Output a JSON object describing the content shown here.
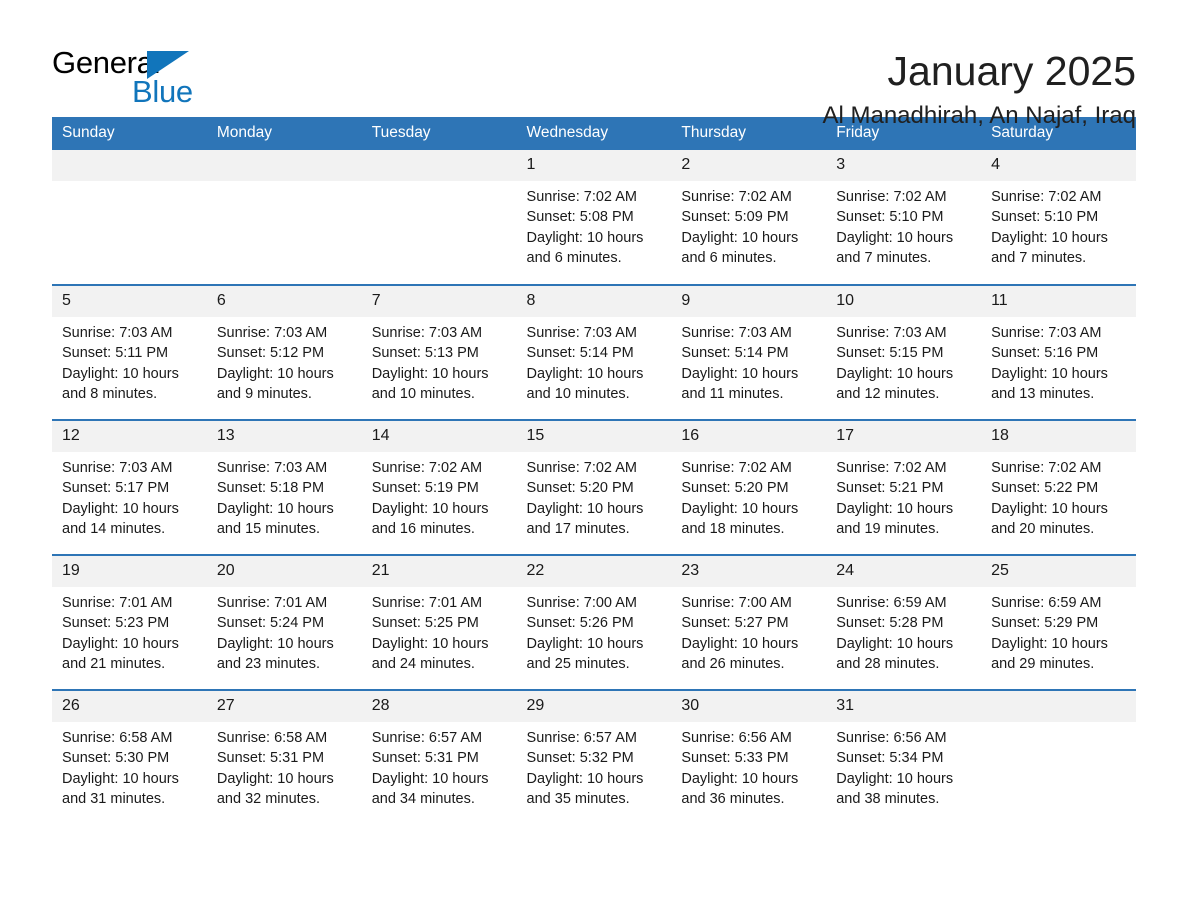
{
  "brand": {
    "name_part1": "General",
    "name_part2": "Blue",
    "triangle_color": "#1175bb",
    "accent_color": "#2e75b6"
  },
  "header": {
    "month_title": "January 2025",
    "location": "Al Manadhirah, An Najaf, Iraq"
  },
  "calendar": {
    "weekday_headers": [
      "Sunday",
      "Monday",
      "Tuesday",
      "Wednesday",
      "Thursday",
      "Friday",
      "Saturday"
    ],
    "weeks": [
      [
        {
          "day": "",
          "sunrise": "",
          "sunset": "",
          "daylight_line1": "",
          "daylight_line2": "",
          "empty": true
        },
        {
          "day": "",
          "sunrise": "",
          "sunset": "",
          "daylight_line1": "",
          "daylight_line2": "",
          "empty": true
        },
        {
          "day": "",
          "sunrise": "",
          "sunset": "",
          "daylight_line1": "",
          "daylight_line2": "",
          "empty": true
        },
        {
          "day": "1",
          "sunrise": "Sunrise: 7:02 AM",
          "sunset": "Sunset: 5:08 PM",
          "daylight_line1": "Daylight: 10 hours",
          "daylight_line2": "and 6 minutes.",
          "empty": false
        },
        {
          "day": "2",
          "sunrise": "Sunrise: 7:02 AM",
          "sunset": "Sunset: 5:09 PM",
          "daylight_line1": "Daylight: 10 hours",
          "daylight_line2": "and 6 minutes.",
          "empty": false
        },
        {
          "day": "3",
          "sunrise": "Sunrise: 7:02 AM",
          "sunset": "Sunset: 5:10 PM",
          "daylight_line1": "Daylight: 10 hours",
          "daylight_line2": "and 7 minutes.",
          "empty": false
        },
        {
          "day": "4",
          "sunrise": "Sunrise: 7:02 AM",
          "sunset": "Sunset: 5:10 PM",
          "daylight_line1": "Daylight: 10 hours",
          "daylight_line2": "and 7 minutes.",
          "empty": false
        }
      ],
      [
        {
          "day": "5",
          "sunrise": "Sunrise: 7:03 AM",
          "sunset": "Sunset: 5:11 PM",
          "daylight_line1": "Daylight: 10 hours",
          "daylight_line2": "and 8 minutes.",
          "empty": false
        },
        {
          "day": "6",
          "sunrise": "Sunrise: 7:03 AM",
          "sunset": "Sunset: 5:12 PM",
          "daylight_line1": "Daylight: 10 hours",
          "daylight_line2": "and 9 minutes.",
          "empty": false
        },
        {
          "day": "7",
          "sunrise": "Sunrise: 7:03 AM",
          "sunset": "Sunset: 5:13 PM",
          "daylight_line1": "Daylight: 10 hours",
          "daylight_line2": "and 10 minutes.",
          "empty": false
        },
        {
          "day": "8",
          "sunrise": "Sunrise: 7:03 AM",
          "sunset": "Sunset: 5:14 PM",
          "daylight_line1": "Daylight: 10 hours",
          "daylight_line2": "and 10 minutes.",
          "empty": false
        },
        {
          "day": "9",
          "sunrise": "Sunrise: 7:03 AM",
          "sunset": "Sunset: 5:14 PM",
          "daylight_line1": "Daylight: 10 hours",
          "daylight_line2": "and 11 minutes.",
          "empty": false
        },
        {
          "day": "10",
          "sunrise": "Sunrise: 7:03 AM",
          "sunset": "Sunset: 5:15 PM",
          "daylight_line1": "Daylight: 10 hours",
          "daylight_line2": "and 12 minutes.",
          "empty": false
        },
        {
          "day": "11",
          "sunrise": "Sunrise: 7:03 AM",
          "sunset": "Sunset: 5:16 PM",
          "daylight_line1": "Daylight: 10 hours",
          "daylight_line2": "and 13 minutes.",
          "empty": false
        }
      ],
      [
        {
          "day": "12",
          "sunrise": "Sunrise: 7:03 AM",
          "sunset": "Sunset: 5:17 PM",
          "daylight_line1": "Daylight: 10 hours",
          "daylight_line2": "and 14 minutes.",
          "empty": false
        },
        {
          "day": "13",
          "sunrise": "Sunrise: 7:03 AM",
          "sunset": "Sunset: 5:18 PM",
          "daylight_line1": "Daylight: 10 hours",
          "daylight_line2": "and 15 minutes.",
          "empty": false
        },
        {
          "day": "14",
          "sunrise": "Sunrise: 7:02 AM",
          "sunset": "Sunset: 5:19 PM",
          "daylight_line1": "Daylight: 10 hours",
          "daylight_line2": "and 16 minutes.",
          "empty": false
        },
        {
          "day": "15",
          "sunrise": "Sunrise: 7:02 AM",
          "sunset": "Sunset: 5:20 PM",
          "daylight_line1": "Daylight: 10 hours",
          "daylight_line2": "and 17 minutes.",
          "empty": false
        },
        {
          "day": "16",
          "sunrise": "Sunrise: 7:02 AM",
          "sunset": "Sunset: 5:20 PM",
          "daylight_line1": "Daylight: 10 hours",
          "daylight_line2": "and 18 minutes.",
          "empty": false
        },
        {
          "day": "17",
          "sunrise": "Sunrise: 7:02 AM",
          "sunset": "Sunset: 5:21 PM",
          "daylight_line1": "Daylight: 10 hours",
          "daylight_line2": "and 19 minutes.",
          "empty": false
        },
        {
          "day": "18",
          "sunrise": "Sunrise: 7:02 AM",
          "sunset": "Sunset: 5:22 PM",
          "daylight_line1": "Daylight: 10 hours",
          "daylight_line2": "and 20 minutes.",
          "empty": false
        }
      ],
      [
        {
          "day": "19",
          "sunrise": "Sunrise: 7:01 AM",
          "sunset": "Sunset: 5:23 PM",
          "daylight_line1": "Daylight: 10 hours",
          "daylight_line2": "and 21 minutes.",
          "empty": false
        },
        {
          "day": "20",
          "sunrise": "Sunrise: 7:01 AM",
          "sunset": "Sunset: 5:24 PM",
          "daylight_line1": "Daylight: 10 hours",
          "daylight_line2": "and 23 minutes.",
          "empty": false
        },
        {
          "day": "21",
          "sunrise": "Sunrise: 7:01 AM",
          "sunset": "Sunset: 5:25 PM",
          "daylight_line1": "Daylight: 10 hours",
          "daylight_line2": "and 24 minutes.",
          "empty": false
        },
        {
          "day": "22",
          "sunrise": "Sunrise: 7:00 AM",
          "sunset": "Sunset: 5:26 PM",
          "daylight_line1": "Daylight: 10 hours",
          "daylight_line2": "and 25 minutes.",
          "empty": false
        },
        {
          "day": "23",
          "sunrise": "Sunrise: 7:00 AM",
          "sunset": "Sunset: 5:27 PM",
          "daylight_line1": "Daylight: 10 hours",
          "daylight_line2": "and 26 minutes.",
          "empty": false
        },
        {
          "day": "24",
          "sunrise": "Sunrise: 6:59 AM",
          "sunset": "Sunset: 5:28 PM",
          "daylight_line1": "Daylight: 10 hours",
          "daylight_line2": "and 28 minutes.",
          "empty": false
        },
        {
          "day": "25",
          "sunrise": "Sunrise: 6:59 AM",
          "sunset": "Sunset: 5:29 PM",
          "daylight_line1": "Daylight: 10 hours",
          "daylight_line2": "and 29 minutes.",
          "empty": false
        }
      ],
      [
        {
          "day": "26",
          "sunrise": "Sunrise: 6:58 AM",
          "sunset": "Sunset: 5:30 PM",
          "daylight_line1": "Daylight: 10 hours",
          "daylight_line2": "and 31 minutes.",
          "empty": false
        },
        {
          "day": "27",
          "sunrise": "Sunrise: 6:58 AM",
          "sunset": "Sunset: 5:31 PM",
          "daylight_line1": "Daylight: 10 hours",
          "daylight_line2": "and 32 minutes.",
          "empty": false
        },
        {
          "day": "28",
          "sunrise": "Sunrise: 6:57 AM",
          "sunset": "Sunset: 5:31 PM",
          "daylight_line1": "Daylight: 10 hours",
          "daylight_line2": "and 34 minutes.",
          "empty": false
        },
        {
          "day": "29",
          "sunrise": "Sunrise: 6:57 AM",
          "sunset": "Sunset: 5:32 PM",
          "daylight_line1": "Daylight: 10 hours",
          "daylight_line2": "and 35 minutes.",
          "empty": false
        },
        {
          "day": "30",
          "sunrise": "Sunrise: 6:56 AM",
          "sunset": "Sunset: 5:33 PM",
          "daylight_line1": "Daylight: 10 hours",
          "daylight_line2": "and 36 minutes.",
          "empty": false
        },
        {
          "day": "31",
          "sunrise": "Sunrise: 6:56 AM",
          "sunset": "Sunset: 5:34 PM",
          "daylight_line1": "Daylight: 10 hours",
          "daylight_line2": "and 38 minutes.",
          "empty": false
        },
        {
          "day": "",
          "sunrise": "",
          "sunset": "",
          "daylight_line1": "",
          "daylight_line2": "",
          "empty": true
        }
      ]
    ]
  }
}
